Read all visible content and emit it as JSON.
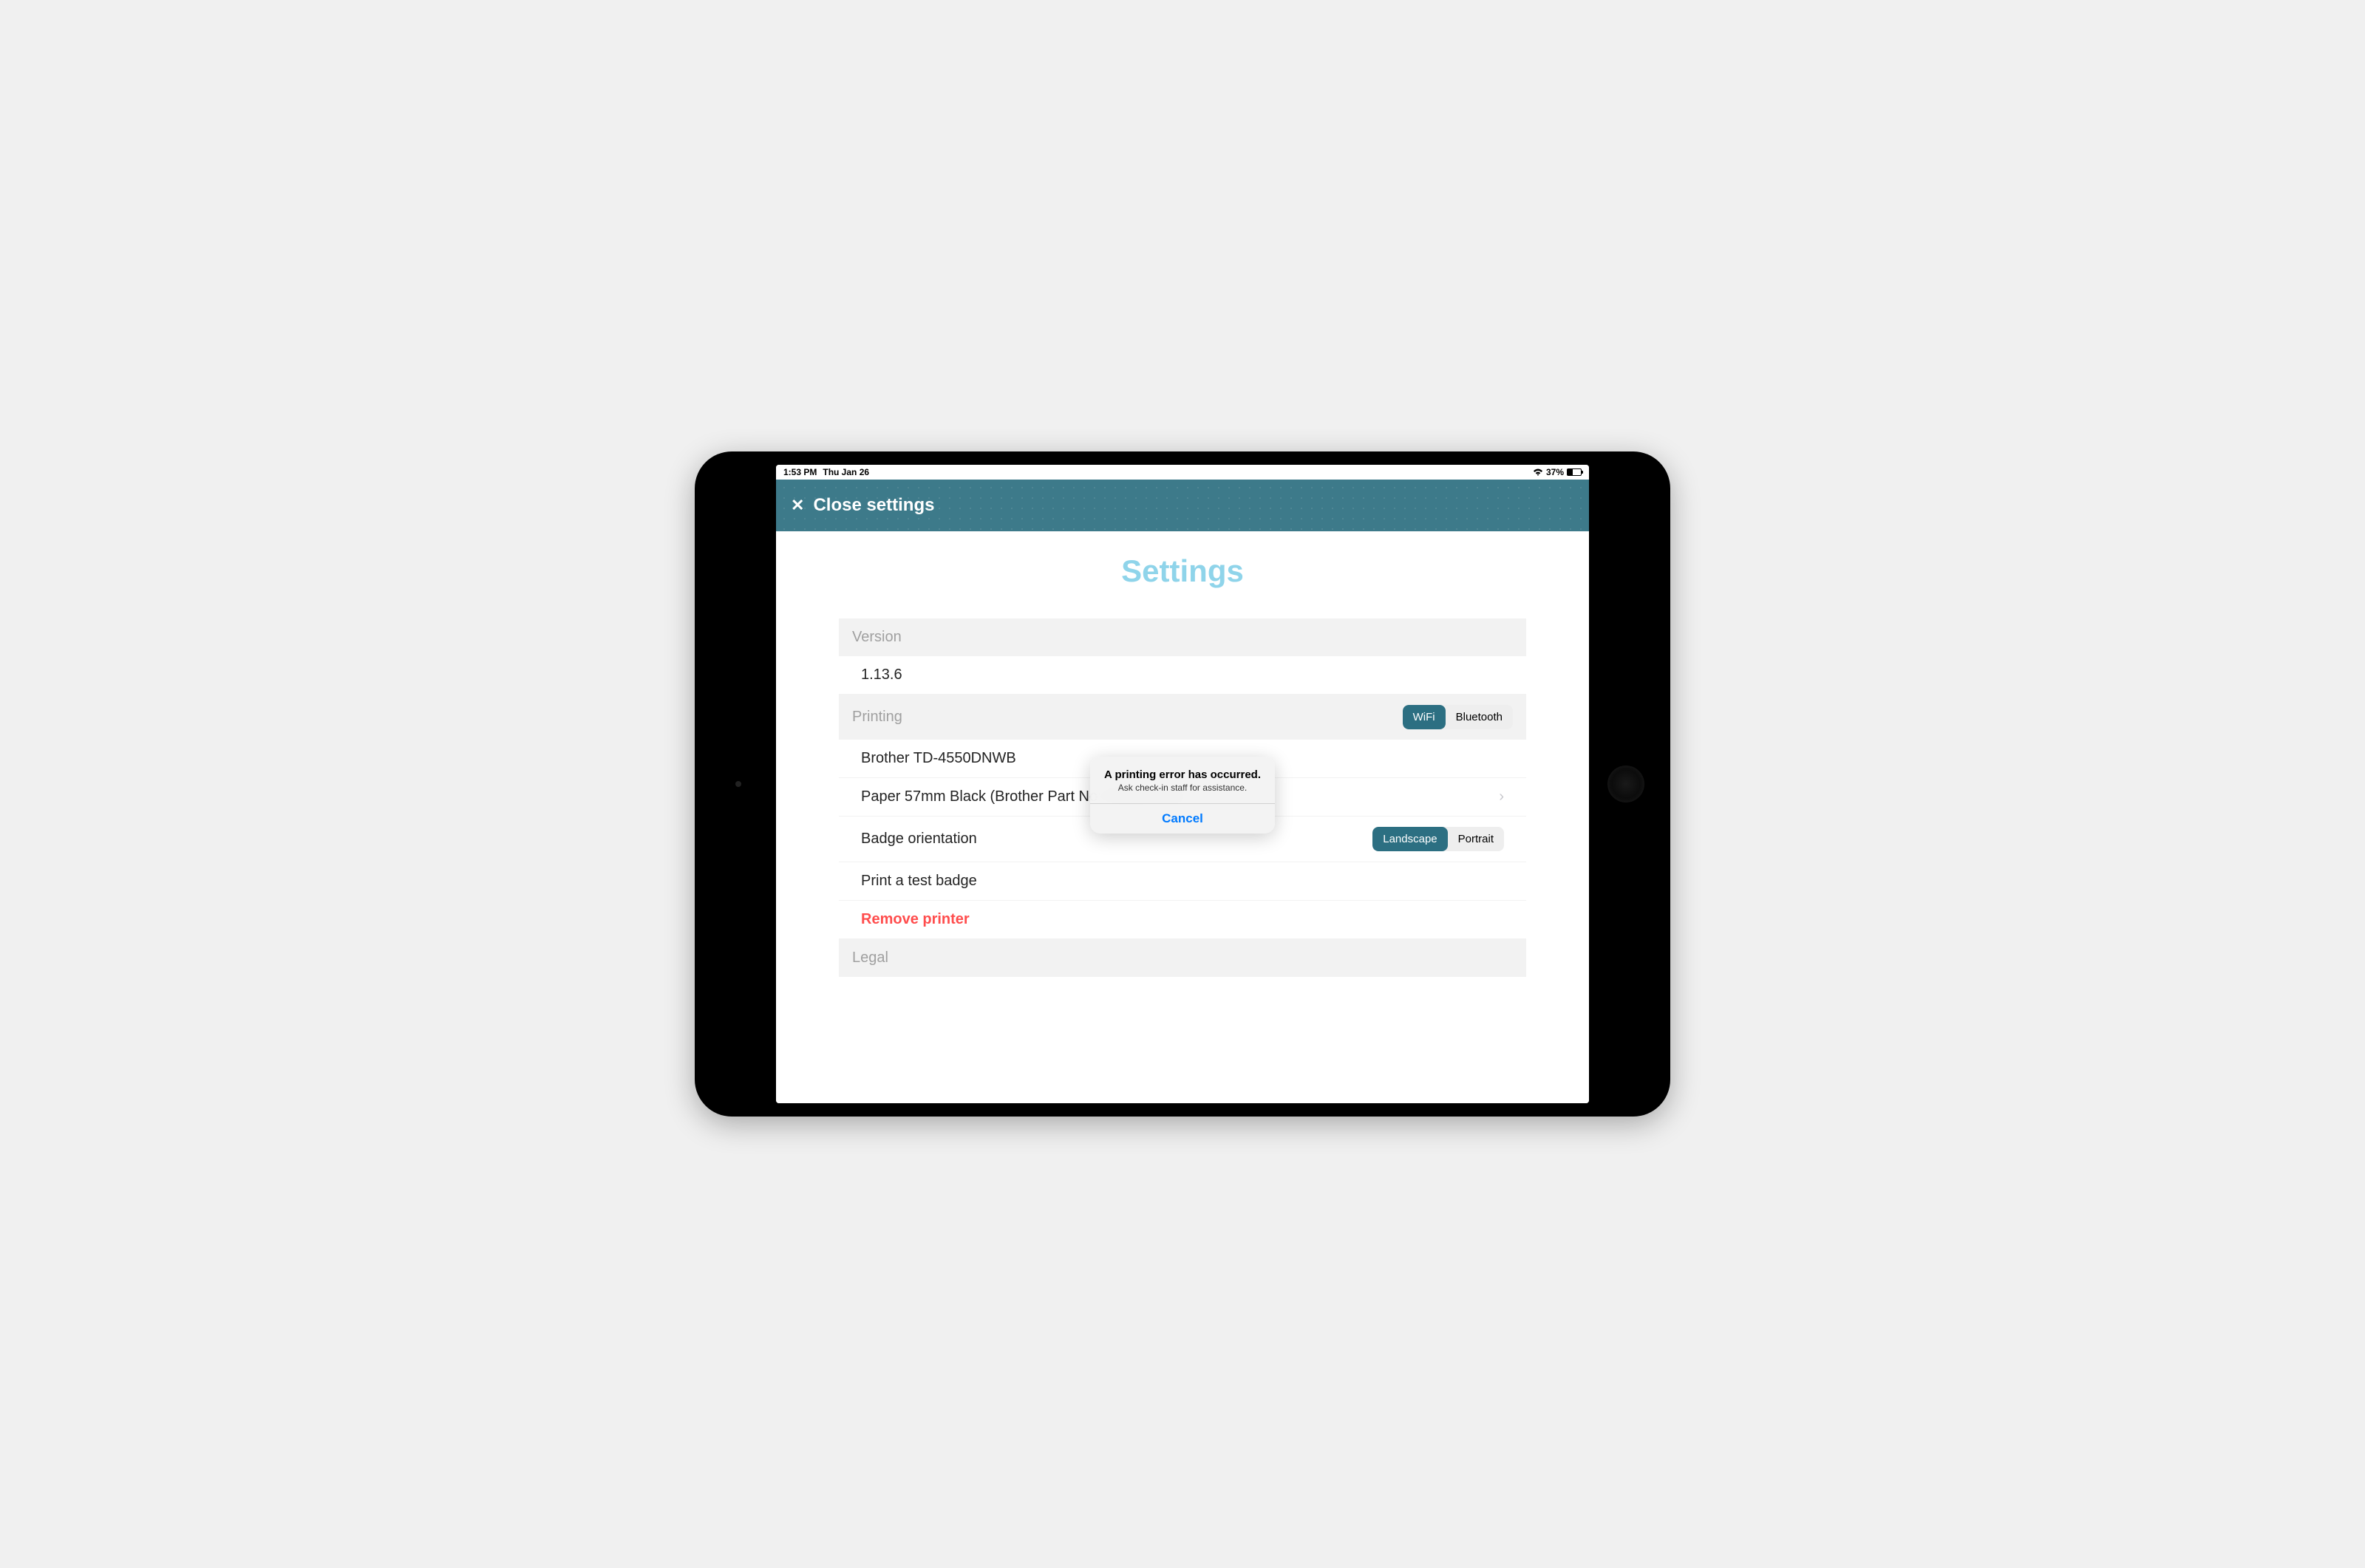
{
  "status_bar": {
    "time": "1:53 PM",
    "date": "Thu Jan 26",
    "battery_pct": "37%"
  },
  "header": {
    "close_label": "Close settings"
  },
  "page": {
    "title": "Settings"
  },
  "sections": {
    "version": {
      "header": "Version",
      "value": "1.13.6"
    },
    "printing": {
      "header": "Printing",
      "connection": {
        "wifi": "WiFi",
        "bluetooth": "Bluetooth",
        "selected": "WiFi"
      },
      "printer_model": "Brother TD-4550DNWB",
      "paper": "Paper 57mm Black (Brother Part No: RD001U1S)",
      "orientation_label": "Badge orientation",
      "orientation": {
        "landscape": "Landscape",
        "portrait": "Portrait",
        "selected": "Landscape"
      },
      "test_badge": "Print a test badge",
      "remove_printer": "Remove printer"
    },
    "legal": {
      "header": "Legal"
    }
  },
  "alert": {
    "title": "A printing error has occurred.",
    "message": "Ask check-in staff for assistance.",
    "cancel": "Cancel"
  }
}
